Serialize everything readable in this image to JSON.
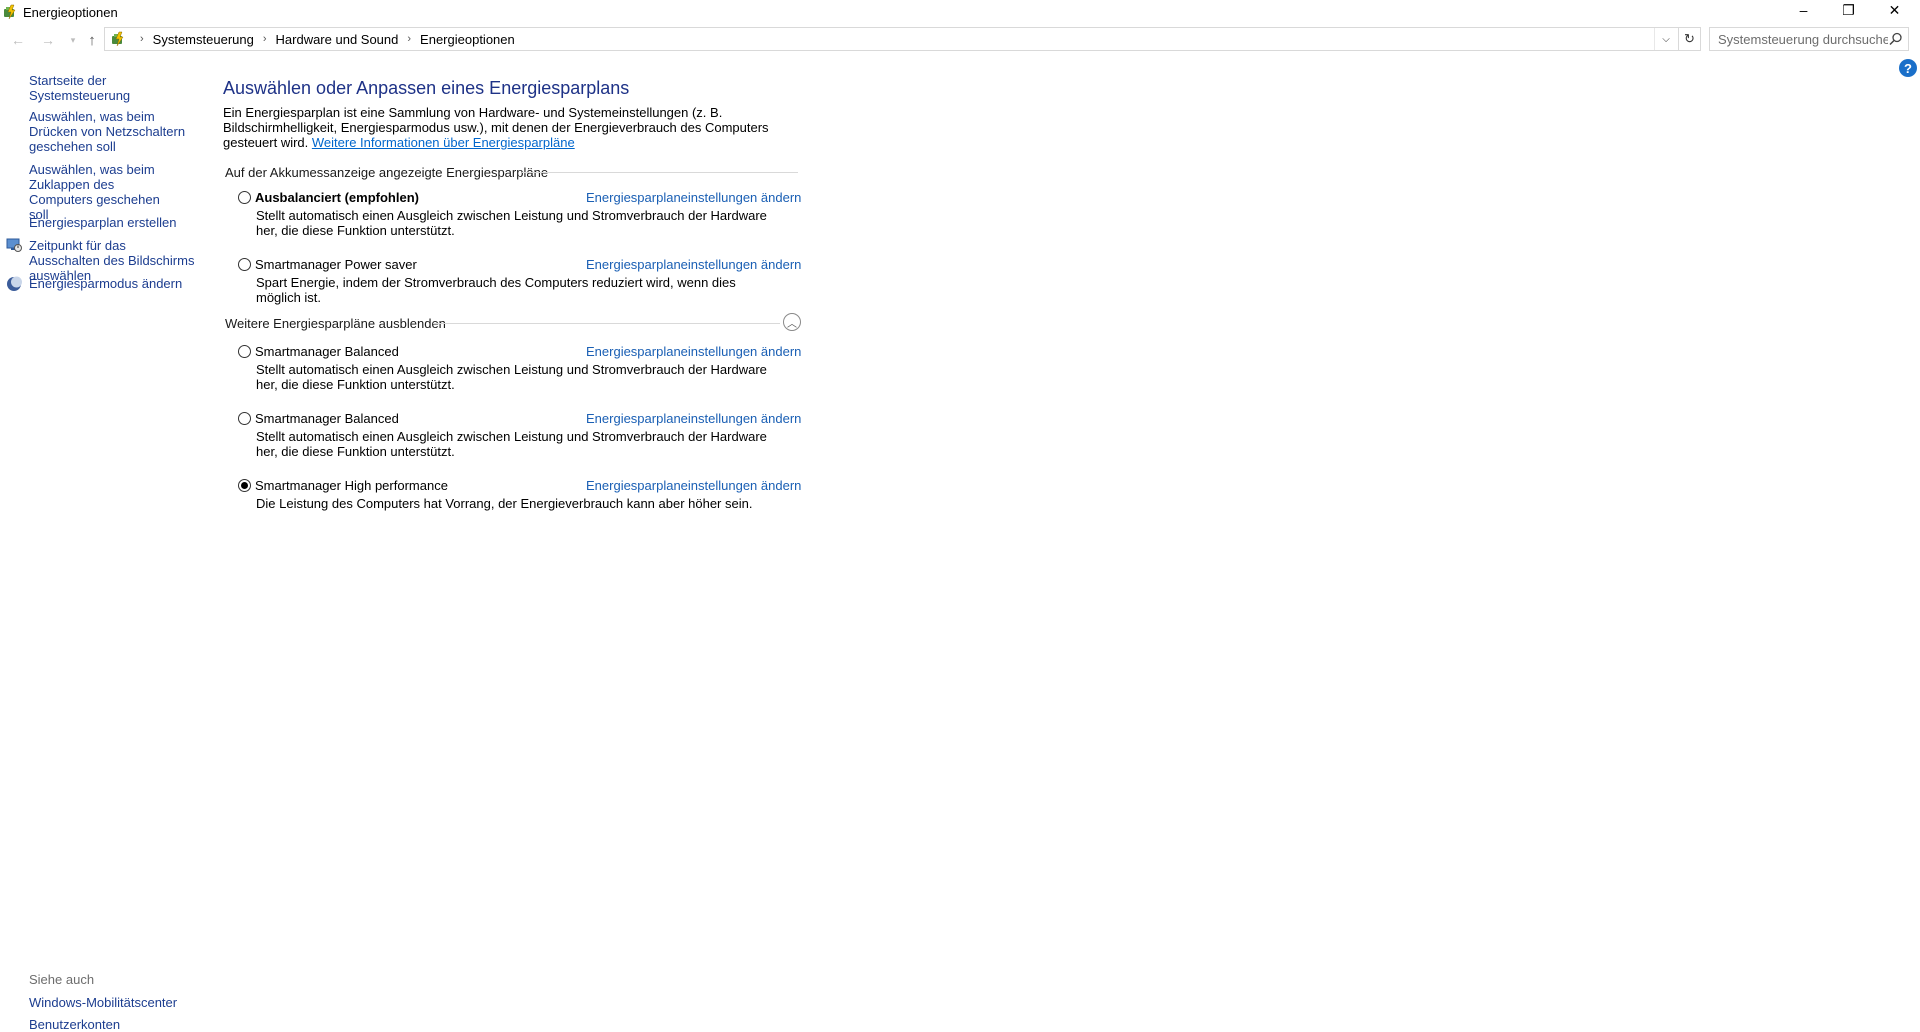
{
  "window": {
    "title": "Energieoptionen",
    "minimize_label": "–",
    "maximize_label": "❐",
    "close_label": "✕"
  },
  "navigation": {
    "breadcrumbs": [
      "Systemsteuerung",
      "Hardware und Sound",
      "Energieoptionen"
    ],
    "search_placeholder": "Systemsteuerung durchsuchen"
  },
  "sidebar": {
    "links": [
      "Startseite der Systemsteuerung",
      "Auswählen, was beim Drücken von Netzschaltern geschehen soll",
      "Auswählen, was beim Zuklappen des Computers geschehen soll",
      "Energiesparplan erstellen",
      "Zeitpunkt für das Ausschalten des Bildschirms auswählen",
      "Energiesparmodus ändern"
    ],
    "see_also": {
      "heading": "Siehe auch",
      "links": [
        "Windows-Mobilitätscenter",
        "Benutzerkonten"
      ]
    }
  },
  "main": {
    "title": "Auswählen oder Anpassen eines Energiesparplans",
    "intro_text": "Ein Energiesparplan ist eine Sammlung von Hardware- und Systemeinstellungen (z. B. Bildschirmhelligkeit, Energiesparmodus usw.), mit denen der Energieverbrauch des Computers gesteuert wird. ",
    "intro_link": "Weitere Informationen über Energiesparpläne",
    "group1_header": "Auf der Akkumessanzeige angezeigte Energiesparpläne",
    "group2_header": "Weitere Energiesparpläne ausblenden",
    "change_link": "Energiesparplaneinstellungen ändern",
    "plans": [
      {
        "name": "Ausbalanciert (empfohlen)",
        "desc": "Stellt automatisch einen Ausgleich zwischen Leistung und Stromverbrauch der Hardware her, die diese Funktion unterstützt.",
        "selected": false
      },
      {
        "name": "Smartmanager Power saver",
        "desc": "Spart Energie, indem der Stromverbrauch des Computers reduziert wird, wenn dies möglich ist.",
        "selected": false
      },
      {
        "name": "Smartmanager Balanced",
        "desc": "Stellt automatisch einen Ausgleich zwischen Leistung und Stromverbrauch der Hardware her, die diese Funktion unterstützt.",
        "selected": false
      },
      {
        "name": "Smartmanager Balanced",
        "desc": "Stellt automatisch einen Ausgleich zwischen Leistung und Stromverbrauch der Hardware her, die diese Funktion unterstützt.",
        "selected": false
      },
      {
        "name": "Smartmanager High performance",
        "desc": "Die Leistung des Computers hat Vorrang, der Energieverbrauch kann aber höher sein.",
        "selected": true
      }
    ]
  }
}
